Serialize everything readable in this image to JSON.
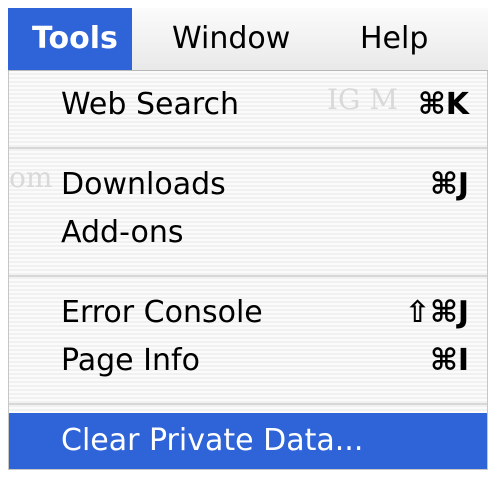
{
  "menubar": {
    "menus": [
      {
        "label": "Tools",
        "active": true
      },
      {
        "label": "Window",
        "active": false
      },
      {
        "label": "Help",
        "active": false
      }
    ]
  },
  "dropdown": {
    "items": [
      {
        "label": "Web Search",
        "shortcut": "⌘K"
      },
      {
        "label": "Downloads",
        "shortcut": "⌘J"
      },
      {
        "label": "Add-ons",
        "shortcut": ""
      },
      {
        "label": "Error Console",
        "shortcut": "⇧⌘J"
      },
      {
        "label": "Page Info",
        "shortcut": "⌘I"
      },
      {
        "label": "Clear Private Data...",
        "shortcut": ""
      }
    ],
    "highlight_color": "#2f63d8"
  }
}
